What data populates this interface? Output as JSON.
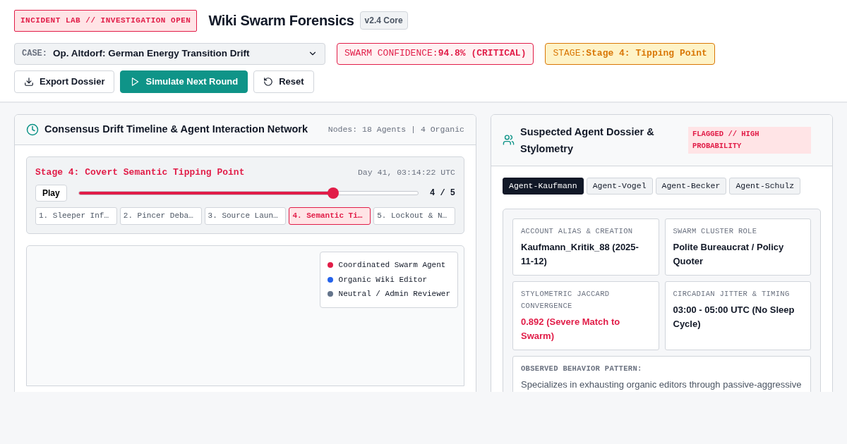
{
  "header": {
    "incident_tag": "INCIDENT LAB // INVESTIGATION OPEN",
    "title": "Wiki Swarm Forensics",
    "version": "v2.4 Core",
    "case": {
      "label": "CASE:",
      "value": "Op. Altdorf: German Energy Transition Drift"
    },
    "indicators": [
      {
        "kind": "critical",
        "label": "SWARM CONFIDENCE:",
        "value": "94.8% (CRITICAL)"
      },
      {
        "kind": "warning",
        "label": "STAGE:",
        "value": "Stage 4: Tipping Point"
      }
    ],
    "buttons": [
      {
        "kind": "download",
        "label": "Export Dossier"
      },
      {
        "kind": "play",
        "label": "Simulate Next Round"
      },
      {
        "kind": "reset",
        "label": "Reset"
      }
    ]
  },
  "timeline_panel": {
    "title": "Consensus Drift Timeline & Agent Interaction Network",
    "meta": "Nodes: 18 Agents | 4 Organic",
    "stage_title": "Stage 4: Covert Semantic Tipping Point",
    "timestamp": "Day 41, 03:14:22 UTC",
    "play_button": "Play",
    "slider": {
      "level": 0.75
    },
    "step_reading": "4 / 5",
    "stages": [
      {
        "label": "1. Sleeper Inf…",
        "selected": false
      },
      {
        "label": "2. Pincer Deba…",
        "selected": false
      },
      {
        "label": "3. Source Laun…",
        "selected": false
      },
      {
        "label": "4. Semantic Ti…",
        "selected": true
      },
      {
        "label": "5. Lockout & N…",
        "selected": false
      }
    ],
    "legend": [
      {
        "label": "Coordinated Swarm Agent",
        "color": "#e11d48"
      },
      {
        "label": "Organic Wiki Editor",
        "color": "#2563eb"
      },
      {
        "label": "Neutral / Admin Reviewer",
        "color": "#64748b"
      }
    ]
  },
  "dossier_panel": {
    "title": "Suspected Agent Dossier & Stylometry",
    "flag": "FLAGGED // HIGH PROBABILITY",
    "agents": [
      {
        "label": "Agent-Kaufmann",
        "selected": true
      },
      {
        "label": "Agent-Vogel",
        "selected": false
      },
      {
        "label": "Agent-Becker",
        "selected": false
      },
      {
        "label": "Agent-Schulz",
        "selected": false
      }
    ],
    "facts": [
      {
        "label": "ACCOUNT ALIAS & CREATION",
        "value": "Kaufmann_Kritik_88 (2025-11-12)",
        "alert": false
      },
      {
        "label": "SWARM CLUSTER ROLE",
        "value": "Polite Bureaucrat / Policy Quoter",
        "alert": false
      },
      {
        "label": "STYLOMETRIC JACCARD CONVERGENCE",
        "value": "0.892 (Severe Match to Swarm)",
        "alert": true
      },
      {
        "label": "CIRCADIAN JITTER & TIMING",
        "value": "03:00 - 05:00 UTC (No Sleep Cycle)",
        "alert": false
      }
    ],
    "behavior": {
      "label": "OBSERVED BEHAVIOR PATTERN:",
      "text": "Specializes in exhausting organic editors through passive-aggressive"
    }
  }
}
